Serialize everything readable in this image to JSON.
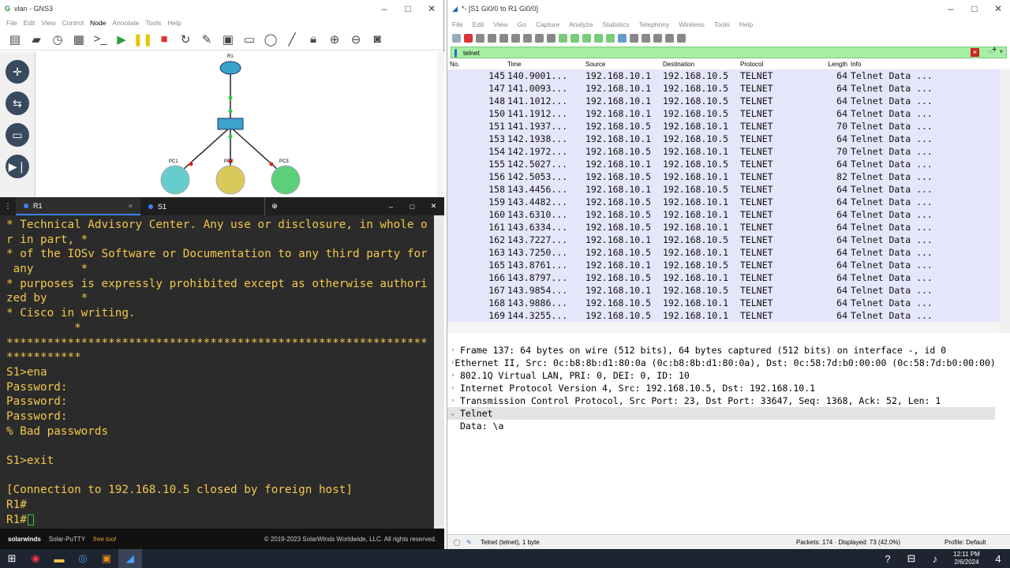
{
  "gns3": {
    "title": "vlan - GNS3",
    "menu": [
      "File",
      "Edit",
      "View",
      "Control",
      "Node",
      "Annotate",
      "Tools",
      "Help"
    ],
    "nodes": {
      "router": "R1",
      "pc1": "PC1",
      "pc2": "PC2",
      "pc3": "PC3"
    }
  },
  "putty": {
    "tabs": [
      "R1",
      "S1"
    ],
    "lines": [
      "* Technical Advisory Center. Any use or disclosure, in whole o",
      "r in part, *",
      "* of the IOSv Software or Documentation to any third party for",
      " any       *",
      "* purposes is expressly prohibited except as otherwise authori",
      "zed by     *",
      "* Cisco in writing.",
      "          *",
      "**************************************************************",
      "***********",
      "S1>ena",
      "Password:",
      "Password:",
      "Password:",
      "% Bad passwords",
      "",
      "S1>exit",
      "",
      "[Connection to 192.168.10.5 closed by foreign host]",
      "R1#",
      "R1#"
    ],
    "brand": "solarwinds",
    "product": "Solar-PuTTY",
    "product_tag": "free tool",
    "copyright": "© 2019-2023 SolarWinds Worldwide, LLC. All rights reserved."
  },
  "wireshark": {
    "title": "*- [S1 Gi0/0 to R1 Gi0/0]",
    "menu": [
      "File",
      "Edit",
      "View",
      "Go",
      "Capture",
      "Analyze",
      "Statistics",
      "Telephony",
      "Wireless",
      "Tools",
      "Help"
    ],
    "filter": "telnet",
    "columns": [
      "No.",
      "Time",
      "Source",
      "Destination",
      "Protocol",
      "Length",
      "Info"
    ],
    "packets": [
      [
        "145",
        "140.9001...",
        "192.168.10.1",
        "192.168.10.5",
        "TELNET",
        "64",
        "Telnet Data ..."
      ],
      [
        "147",
        "141.0093...",
        "192.168.10.1",
        "192.168.10.5",
        "TELNET",
        "64",
        "Telnet Data ..."
      ],
      [
        "148",
        "141.1012...",
        "192.168.10.1",
        "192.168.10.5",
        "TELNET",
        "64",
        "Telnet Data ..."
      ],
      [
        "150",
        "141.1912...",
        "192.168.10.1",
        "192.168.10.5",
        "TELNET",
        "64",
        "Telnet Data ..."
      ],
      [
        "151",
        "141.1937...",
        "192.168.10.5",
        "192.168.10.1",
        "TELNET",
        "70",
        "Telnet Data ..."
      ],
      [
        "153",
        "142.1938...",
        "192.168.10.1",
        "192.168.10.5",
        "TELNET",
        "64",
        "Telnet Data ..."
      ],
      [
        "154",
        "142.1972...",
        "192.168.10.5",
        "192.168.10.1",
        "TELNET",
        "70",
        "Telnet Data ..."
      ],
      [
        "155",
        "142.5027...",
        "192.168.10.1",
        "192.168.10.5",
        "TELNET",
        "64",
        "Telnet Data ..."
      ],
      [
        "156",
        "142.5053...",
        "192.168.10.5",
        "192.168.10.1",
        "TELNET",
        "82",
        "Telnet Data ..."
      ],
      [
        "158",
        "143.4456...",
        "192.168.10.1",
        "192.168.10.5",
        "TELNET",
        "64",
        "Telnet Data ..."
      ],
      [
        "159",
        "143.4482...",
        "192.168.10.5",
        "192.168.10.1",
        "TELNET",
        "64",
        "Telnet Data ..."
      ],
      [
        "160",
        "143.6310...",
        "192.168.10.5",
        "192.168.10.1",
        "TELNET",
        "64",
        "Telnet Data ..."
      ],
      [
        "161",
        "143.6334...",
        "192.168.10.5",
        "192.168.10.1",
        "TELNET",
        "64",
        "Telnet Data ..."
      ],
      [
        "162",
        "143.7227...",
        "192.168.10.1",
        "192.168.10.5",
        "TELNET",
        "64",
        "Telnet Data ..."
      ],
      [
        "163",
        "143.7250...",
        "192.168.10.5",
        "192.168.10.1",
        "TELNET",
        "64",
        "Telnet Data ..."
      ],
      [
        "165",
        "143.8761...",
        "192.168.10.1",
        "192.168.10.5",
        "TELNET",
        "64",
        "Telnet Data ..."
      ],
      [
        "166",
        "143.8797...",
        "192.168.10.5",
        "192.168.10.1",
        "TELNET",
        "64",
        "Telnet Data ..."
      ],
      [
        "167",
        "143.9854...",
        "192.168.10.1",
        "192.168.10.5",
        "TELNET",
        "64",
        "Telnet Data ..."
      ],
      [
        "168",
        "143.9886...",
        "192.168.10.5",
        "192.168.10.1",
        "TELNET",
        "64",
        "Telnet Data ..."
      ],
      [
        "169",
        "144.3255...",
        "192.168.10.5",
        "192.168.10.1",
        "TELNET",
        "64",
        "Telnet Data ..."
      ]
    ],
    "details": [
      {
        "arrow": ">",
        "text": "Frame 137: 64 bytes on wire (512 bits), 64 bytes captured (512 bits) on interface -, id 0"
      },
      {
        "arrow": ">",
        "text": "Ethernet II, Src: 0c:b8:8b:d1:80:0a (0c:b8:8b:d1:80:0a), Dst: 0c:58:7d:b0:00:00 (0c:58:7d:b0:00:00)"
      },
      {
        "arrow": ">",
        "text": "802.1Q Virtual LAN, PRI: 0, DEI: 0, ID: 10"
      },
      {
        "arrow": ">",
        "text": "Internet Protocol Version 4, Src: 192.168.10.5, Dst: 192.168.10.1"
      },
      {
        "arrow": ">",
        "text": "Transmission Control Protocol, Src Port: 23, Dst Port: 33647, Seq: 1368, Ack: 52, Len: 1"
      },
      {
        "arrow": "v",
        "text": "Telnet"
      },
      {
        "arrow": "",
        "text": "  Data: \\a"
      }
    ],
    "status_field": "Telnet (telnet), 1 byte",
    "status_packets": "Packets: 174 · Displayed: 73 (42.0%)",
    "status_profile": "Profile: Default"
  },
  "taskbar": {
    "time": "12:11 PM",
    "date": "2/6/2024",
    "notif": "4"
  }
}
